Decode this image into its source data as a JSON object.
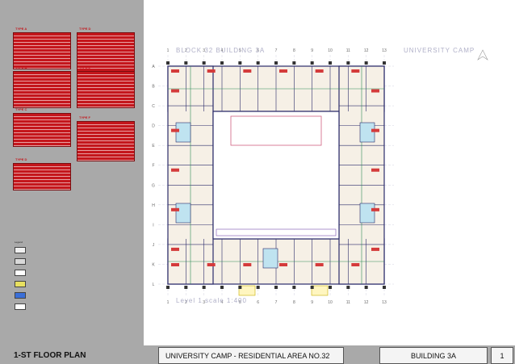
{
  "schedules": [
    {
      "title": "TYPE A",
      "rows": 11
    },
    {
      "title": "TYPE B",
      "rows": 11
    },
    {
      "title": "TYPE C",
      "rows": 10
    },
    {
      "title": "TYPE D",
      "rows": 8
    },
    {
      "title": "TYPE D",
      "rows": 12
    },
    {
      "title": "TYPE E",
      "rows": 11
    },
    {
      "title": "TYPE F",
      "rows": 12
    }
  ],
  "legend": {
    "title": "Legend",
    "items": [
      {
        "color": "#f0f0f0",
        "label": ""
      },
      {
        "color": "#d9d9d9",
        "label": ""
      },
      {
        "color": "#ffffff",
        "label": ""
      },
      {
        "color": "#e8e060",
        "label": ""
      },
      {
        "color": "#3a6fd8",
        "label": ""
      },
      {
        "color": "#ffffff",
        "label": ""
      }
    ]
  },
  "plan": {
    "block_label": "BLOCK 32  BUILDING 3A",
    "camp_label": "UNIVERSITY CAMP",
    "level_label": "Level 1  scale 1:400",
    "grid_numbers": [
      "1",
      "2",
      "3",
      "4",
      "5",
      "6",
      "7",
      "8",
      "9",
      "10",
      "11",
      "12",
      "13"
    ],
    "grid_letters": [
      "A",
      "B",
      "C",
      "D",
      "E",
      "F",
      "G",
      "H",
      "I",
      "J",
      "K",
      "L"
    ]
  },
  "footer": {
    "sheet_title": "1-ST FLOOR PLAN",
    "project": "UNIVERSITY CAMP - RESIDENTIAL AREA NO.32",
    "building": "BUILDING 3A",
    "page": "1"
  },
  "colors": {
    "panel": "#a9a9a9",
    "schedule": "#c4161c",
    "wall": "#2b2b6a",
    "apartment_fill": "#f6f0e6",
    "courtyard_outline": "#d06080"
  }
}
